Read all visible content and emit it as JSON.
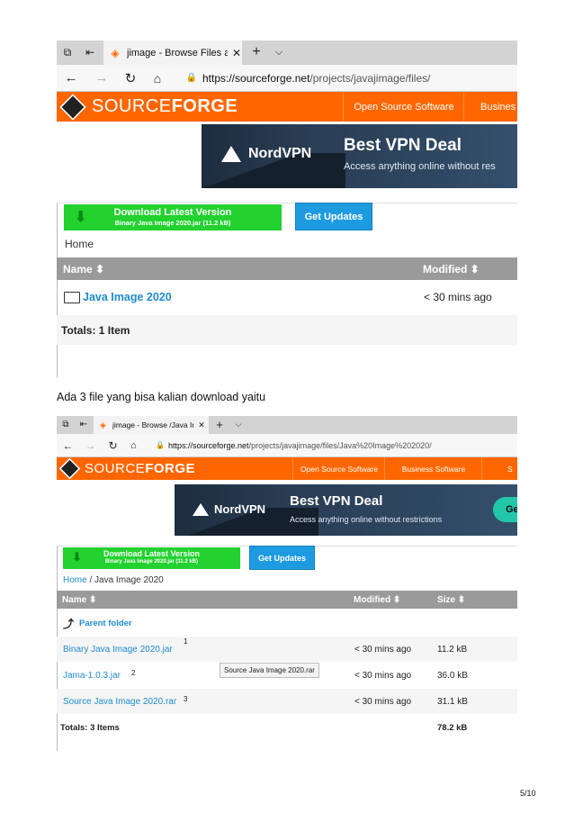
{
  "shot1": {
    "tab_title": "jimage - Browse Files at",
    "url_host": "https://sourceforge.net",
    "url_path": "/projects/javajimage/files/",
    "logo_left": "SOURCE",
    "logo_right": "FORGE",
    "nav": [
      "Open Source Software",
      "Busines"
    ],
    "ad": {
      "brand": "NordVPN",
      "headline": "Best VPN Deal",
      "sub": "Access anything online without res"
    },
    "download": {
      "title": "Download Latest Version",
      "file": "Binary Java Image 2020.jar (11.2 kB)"
    },
    "updates_label": "Get Updates",
    "breadcrumb": "Home",
    "columns": {
      "name": "Name ⬍",
      "modified": "Modified ⬍"
    },
    "rows": [
      {
        "name": "Java Image 2020",
        "modified": "< 30 mins ago"
      }
    ],
    "totals": "Totals: 1 Item"
  },
  "paragraph": "Ada 3 file yang bisa kalian download yaitu",
  "shot2": {
    "tab_title": "jimage - Browse /Java Ir",
    "url_host": "https://sourceforge.net",
    "url_path": "/projects/javajimage/files/Java%20Image%202020/",
    "logo_left": "SOURCE",
    "logo_right": "FORGE",
    "nav": [
      "Open Source Software",
      "Business Software",
      "S"
    ],
    "ad": {
      "brand": "NordVPN",
      "headline": "Best VPN Deal",
      "sub": "Access anything online without restrictions",
      "cta": "Ge"
    },
    "download": {
      "title": "Download Latest Version",
      "file": "Binary Java Image 2020.jar (11.2 kB)"
    },
    "updates_label": "Get Updates",
    "breadcrumb_home": "Home",
    "breadcrumb_sep": " / Java Image 2020",
    "columns": {
      "name": "Name ⬍",
      "modified": "Modified ⬍",
      "size": "Size ⬍"
    },
    "parent_folder": "Parent folder",
    "rows": [
      {
        "name": "Binary Java Image 2020.jar",
        "modified": "< 30 mins ago",
        "size": "11.2 kB",
        "marker": "1"
      },
      {
        "name": "Jama-1.0.3.jar",
        "modified": "< 30 mins ago",
        "size": "36.0 kB",
        "marker": "2"
      },
      {
        "name": "Source Java Image 2020.rar",
        "modified": "< 30 mins ago",
        "size": "31.1 kB",
        "marker": "3"
      }
    ],
    "tooltip": "Source Java Image 2020.rar",
    "totals": "Totals: 3 Items",
    "totals_size": "78.2 kB"
  },
  "page_number": "5/10",
  "colors": {
    "sf_orange": "#ff6600",
    "download_green": "#23d12f",
    "updates_blue": "#1e9be0",
    "link_blue": "#1e8ccf",
    "header_gray": "#9a9a9a"
  }
}
